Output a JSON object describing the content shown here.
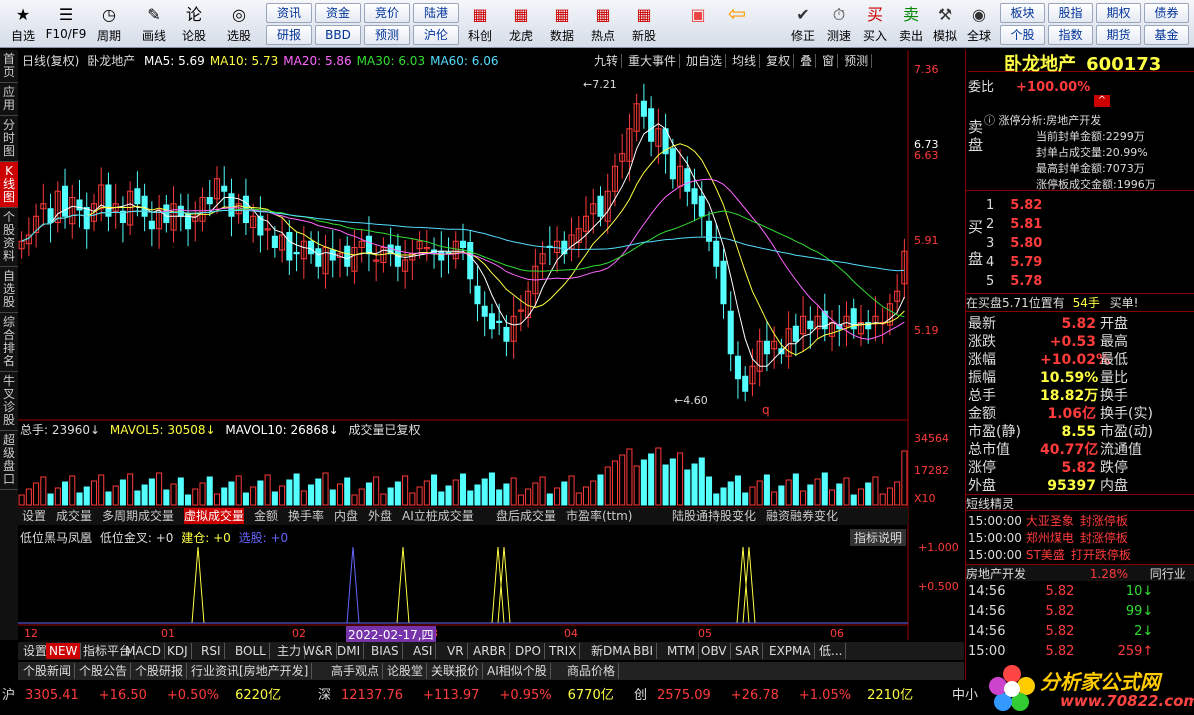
{
  "toolbar": {
    "buttons": [
      "自选",
      "F10/F9",
      "周期",
      "画线",
      "论股",
      "选股"
    ],
    "small_buttons": [
      "资讯",
      "研报",
      "资金",
      "BBD",
      "竞价",
      "预测",
      "陆港",
      "沪伦"
    ],
    "big_buttons": [
      "科创",
      "龙虎",
      "数据",
      "热点",
      "新股"
    ],
    "right_buttons": [
      "修正",
      "测速",
      "买入",
      "卖出",
      "模拟",
      "全球"
    ],
    "right_small": [
      "板块",
      "个股",
      "股指",
      "指数",
      "期权",
      "期货",
      "债券",
      "基金"
    ]
  },
  "left_tabs": [
    "首页",
    "应用",
    "分时图",
    "K线图",
    "个股资料",
    "自选股",
    "综合排名",
    "牛叉诊股",
    "超级盘口"
  ],
  "chart": {
    "title": "日线(复权)",
    "stock_name": "卧龙地产",
    "ma": [
      {
        "label": "MA5: 5.69",
        "color": "#ffffff"
      },
      {
        "label": "MA10: 5.73",
        "color": "#ffff44"
      },
      {
        "label": "MA20: 5.86",
        "color": "#ff66ff"
      },
      {
        "label": "MA30: 6.03",
        "color": "#33dd33"
      },
      {
        "label": "MA60: 6.06",
        "color": "#55ddff"
      }
    ],
    "menu": [
      "九转",
      "重大事件",
      "加自选",
      "均线",
      "复权",
      "叠",
      "窗",
      "预测"
    ],
    "price_axis": [
      "7.36",
      "6.73",
      "6.63",
      "5.91",
      "5.19"
    ],
    "high_label": "7.21",
    "low_label": "4.60",
    "q_mark": "q",
    "volume_line": {
      "total": "总手: 23960↓",
      "mavol5": "MAVOL5: 30508↓",
      "mavol10": "MAVOL10: 26868↓",
      "note": "成交量已复权"
    },
    "volume_axis": [
      "34564",
      "17282",
      "X10"
    ],
    "sub_tabs": [
      "设置",
      "成交量",
      "多周期成交量",
      "虚拟成交量",
      "金额",
      "换手率",
      "内盘",
      "外盘",
      "AI立桩成交量",
      "盘后成交量",
      "市盈率(ttm)",
      "陆股通持股变化",
      "融资融券变化"
    ],
    "indicator_line": {
      "name": "低位黑马凤凰",
      "a": "低位金叉: +0",
      "b": "建仓: +0",
      "c": "选股: +0",
      "btn": "指标说明"
    },
    "indicator_axis": [
      "+1.000",
      "+0.500"
    ],
    "date_axis": [
      "12",
      "01",
      "02",
      "03",
      "04",
      "05",
      "06"
    ],
    "date_highlight": "2022-02-17,四"
  },
  "bottom_tabs": [
    "设置",
    "NEW",
    "指标平台",
    "MACD",
    "KDJ",
    "RSI",
    "BOLL",
    "主力",
    "W&R",
    "DMI",
    "BIAS",
    "ASI",
    "VR",
    "ARBR",
    "DPO",
    "TRIX",
    "新DMA",
    "BBI",
    "MTM",
    "OBV",
    "SAR",
    "EXPMA",
    "低..."
  ],
  "news_tabs": [
    "个股新闻",
    "个股公告",
    "个股研报",
    "行业资讯[房地产开发]",
    "高手观点",
    "论股堂",
    "关联报价",
    "AI相似个股",
    "商品价格"
  ],
  "right": {
    "name": "卧龙地产",
    "code": "600173",
    "wb_label": "委比",
    "wb_value": "+100.00%",
    "limit": {
      "title": "涨停分析:房地产开发",
      "lines": [
        "当前封单金额:2299万",
        "封单占成交量:20.99%",
        "最高封单金额:7073万",
        "涨停板成交金额:1996万"
      ]
    },
    "sell_label": [
      "卖",
      "盘"
    ],
    "buy_label": [
      "买",
      "盘"
    ],
    "buy_levels": [
      {
        "n": "1",
        "p": "5.82"
      },
      {
        "n": "2",
        "p": "5.81"
      },
      {
        "n": "3",
        "p": "5.80"
      },
      {
        "n": "4",
        "p": "5.79"
      },
      {
        "n": "5",
        "p": "5.78"
      }
    ],
    "note": "在买盘5.71位置有",
    "note_vol": "54手",
    "note_tag": "买单!",
    "stats": [
      [
        "最新",
        "5.82",
        "开盘"
      ],
      [
        "涨跌",
        "+0.53",
        "最高"
      ],
      [
        "涨幅",
        "+10.02%",
        "最低"
      ],
      [
        "振幅",
        "10.59%",
        "量比"
      ],
      [
        "总手",
        "18.82万",
        "换手"
      ],
      [
        "金额",
        "1.06亿",
        "换手(实)"
      ],
      [
        "市盈(静)",
        "8.55",
        "市盈(动)"
      ],
      [
        "总市值",
        "40.77亿",
        "流通值"
      ],
      [
        "涨停",
        "5.82",
        "跌停"
      ],
      [
        "外盘",
        "95397",
        "内盘"
      ]
    ],
    "short_title": "短线精灵",
    "short": [
      [
        "15:00:00",
        "大亚圣象",
        "封涨停板"
      ],
      [
        "15:00:00",
        "郑州煤电",
        "封涨停板"
      ],
      [
        "15:00:00",
        "ST美盛",
        "打开跌停板"
      ]
    ],
    "sector": "房地产开发",
    "sector_pct": "1.28%",
    "sector_tag": "同行业",
    "ticks": [
      [
        "14:56",
        "5.82",
        "10"
      ],
      [
        "14:56",
        "5.82",
        "99"
      ],
      [
        "14:56",
        "5.82",
        "2"
      ],
      [
        "15:00",
        "5.82",
        "259"
      ]
    ]
  },
  "index_bar": [
    {
      "n": "沪",
      "v": "3305.41",
      "c": "+16.50",
      "p": "+0.50%",
      "a": "6220亿"
    },
    {
      "n": "深",
      "v": "12137.76",
      "c": "+113.97",
      "p": "+0.95%",
      "a": "6770亿"
    },
    {
      "n": "创",
      "v": "2575.09",
      "c": "+26.78",
      "p": "+1.05%",
      "a": "2210亿"
    }
  ],
  "index_tail": "中小",
  "logo": {
    "text": "分析家公式网",
    "url": "www.70822.com"
  },
  "colors": {
    "up": "#ff3b3b",
    "down": "#54ffff",
    "bg": "#000000",
    "axis": "#990000"
  }
}
